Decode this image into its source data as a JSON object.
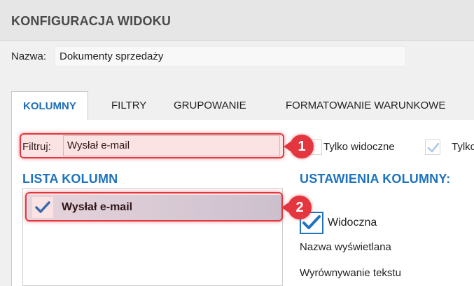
{
  "dialog": {
    "title": "KONFIGURACJA WIDOKU",
    "name_label": "Nazwa:",
    "name_value": "Dokumenty sprzedaży"
  },
  "tabs": [
    {
      "label": "KOLUMNY",
      "active": true
    },
    {
      "label": "FILTRY",
      "active": false
    },
    {
      "label": "GRUPOWANIE",
      "active": false
    },
    {
      "label": "FORMATOWANIE WARUNKOWE",
      "active": false
    }
  ],
  "filter": {
    "label": "Filtruj:",
    "value": "Wysłał e-mail"
  },
  "options": {
    "visible_only_label": "Tylko widoczne",
    "visible_only_checked": false,
    "second_label": "Tylko",
    "second_checked": true
  },
  "columns_list": {
    "heading": "LISTA KOLUMN",
    "items": [
      {
        "label": "Wysłał e-mail",
        "checked": true
      }
    ]
  },
  "column_settings": {
    "heading": "USTAWIENIA KOLUMNY:",
    "visible_label": "Widoczna",
    "visible_checked": true,
    "display_name_label": "Nazwa wyświetlana",
    "text_align_label": "Wyrównywanie tekstu"
  },
  "annotations": {
    "badge_1": "1",
    "badge_2": "2"
  },
  "colors": {
    "accent_blue": "#1e73be",
    "highlight_red": "#e3363f"
  }
}
